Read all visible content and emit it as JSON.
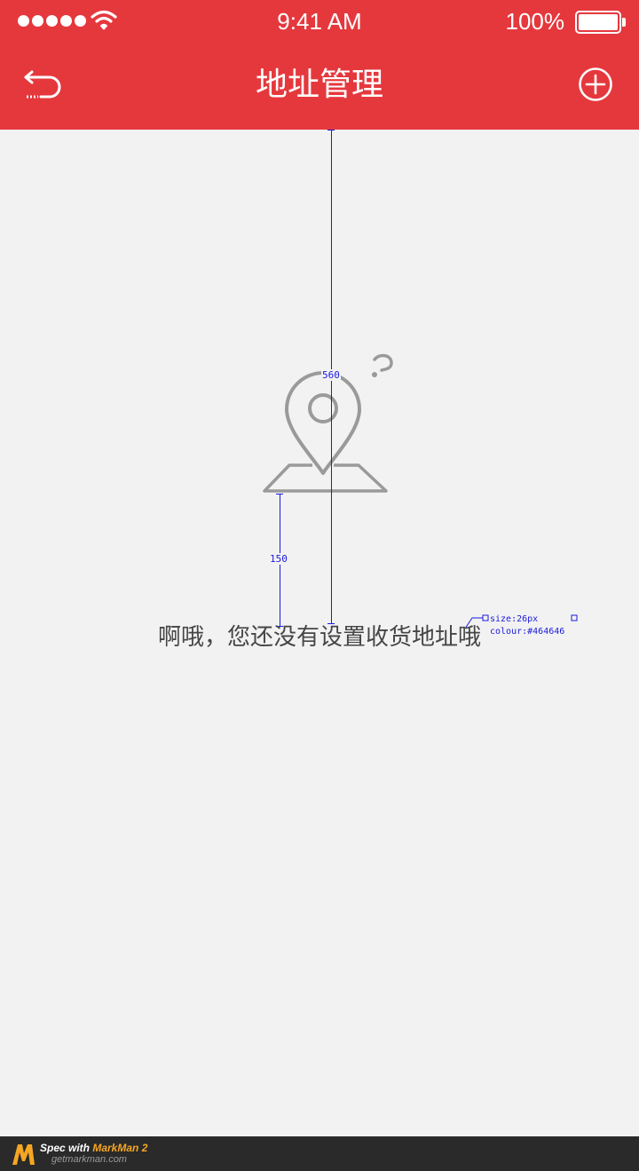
{
  "status_bar": {
    "time": "9:41 AM",
    "battery_percent": "100%",
    "signal_icon": "signal-dots-icon",
    "wifi_icon": "wifi-icon",
    "battery_icon": "battery-icon"
  },
  "nav": {
    "title": "地址管理",
    "back_icon": "back-arrow-icon",
    "add_icon": "plus-circle-icon"
  },
  "empty_state": {
    "icon": "location-pin-question-icon",
    "message": "啊哦，您还没有设置收货地址哦"
  },
  "annotations": {
    "vertical_measure": "560",
    "icon_text_gap": "150",
    "text_size": "size:26px",
    "text_colour": "colour:#464646"
  },
  "footer": {
    "spec_prefix": "Spec with ",
    "brand": "MarkMan 2",
    "url": "getmarkman.com"
  },
  "colors": {
    "header_bg": "#e5383d",
    "page_bg": "#f2f2f2",
    "text": "#464646",
    "icon_gray": "#9a9a9a",
    "annotation_blue": "#1a1adf"
  }
}
